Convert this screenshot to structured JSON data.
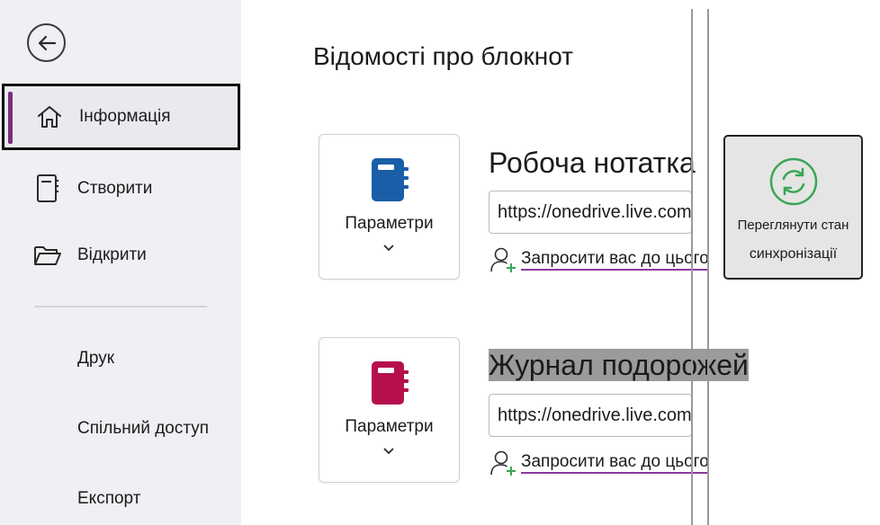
{
  "sidebar": {
    "back_icon": "arrow-left-circle-icon",
    "items": [
      {
        "label": "Інформація",
        "icon": "home-icon",
        "selected": true
      },
      {
        "label": "Створити",
        "icon": "new-notebook-icon"
      },
      {
        "label": "Відкрити",
        "icon": "folder-open-icon"
      }
    ],
    "sub_items": [
      {
        "label": "Друк"
      },
      {
        "label": "Спільний доступ"
      },
      {
        "label": "Експорт"
      }
    ]
  },
  "main": {
    "title": "Відомості про блокнот",
    "notebooks": [
      {
        "name": "Робоча нотатка",
        "color": "#1a5ea8",
        "options_label": "Параметри",
        "url": "https://onedrive.live.com/",
        "invite_label": "Запросити вас до цього"
      },
      {
        "name": "Журнал подорожей",
        "color": "#b5104d",
        "options_label": "Параметри",
        "url": "https://onedrive.live.com/",
        "invite_label": "Запросити вас до цього"
      }
    ],
    "sync": {
      "line1": "Переглянути стан",
      "line2": "синхронізації",
      "icon": "sync-icon",
      "icon_color": "#3aa655"
    }
  },
  "colors": {
    "sidebar_bg": "#eef0f3",
    "accent": "#7a2d83",
    "invite_plus": "#3aa655"
  }
}
